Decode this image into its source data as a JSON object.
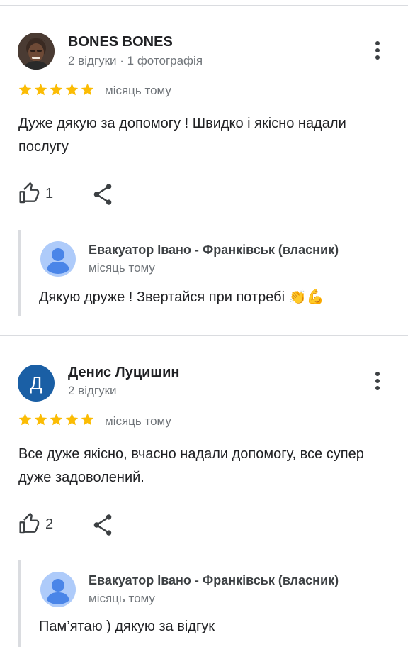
{
  "reviews": [
    {
      "author": "BONES BONES",
      "meta": "2 відгуки · 1 фотографія",
      "avatar_letter": "",
      "rating": 5,
      "time": "місяць тому",
      "text": "Дуже дякую за допомогу ! Швидко і якісно надали послугу",
      "likes": "1",
      "reply": {
        "owner": "Евакуатор Івано - Франківськ (власник)",
        "time": "місяць тому",
        "text": "Дякую друже ! Звертайся при потребі 👏💪"
      }
    },
    {
      "author": "Денис Луцишин",
      "meta": "2 відгуки",
      "avatar_letter": "Д",
      "rating": 5,
      "time": "місяць тому",
      "text": "Все дуже якісно, вчасно надали допомогу, все супер дуже задоволений.",
      "likes": "2",
      "reply": {
        "owner": "Евакуатор Івано - Франківськ (власник)",
        "time": "місяць тому",
        "text": "Пам’ятаю ) дякую за відгук"
      }
    }
  ],
  "colors": {
    "star": "#fbbc04",
    "avatar_letter_bg": "#1a5fa5",
    "owner_avatar_bg": "#aecbfa",
    "owner_avatar_fg": "#4a85e8",
    "divider": "#dadce0",
    "secondary_text": "#70757a"
  },
  "icons": {
    "more": "more-vert-icon",
    "like": "thumb-up-icon",
    "share": "share-icon",
    "star": "star-icon",
    "owner_avatar": "person-avatar-icon"
  }
}
